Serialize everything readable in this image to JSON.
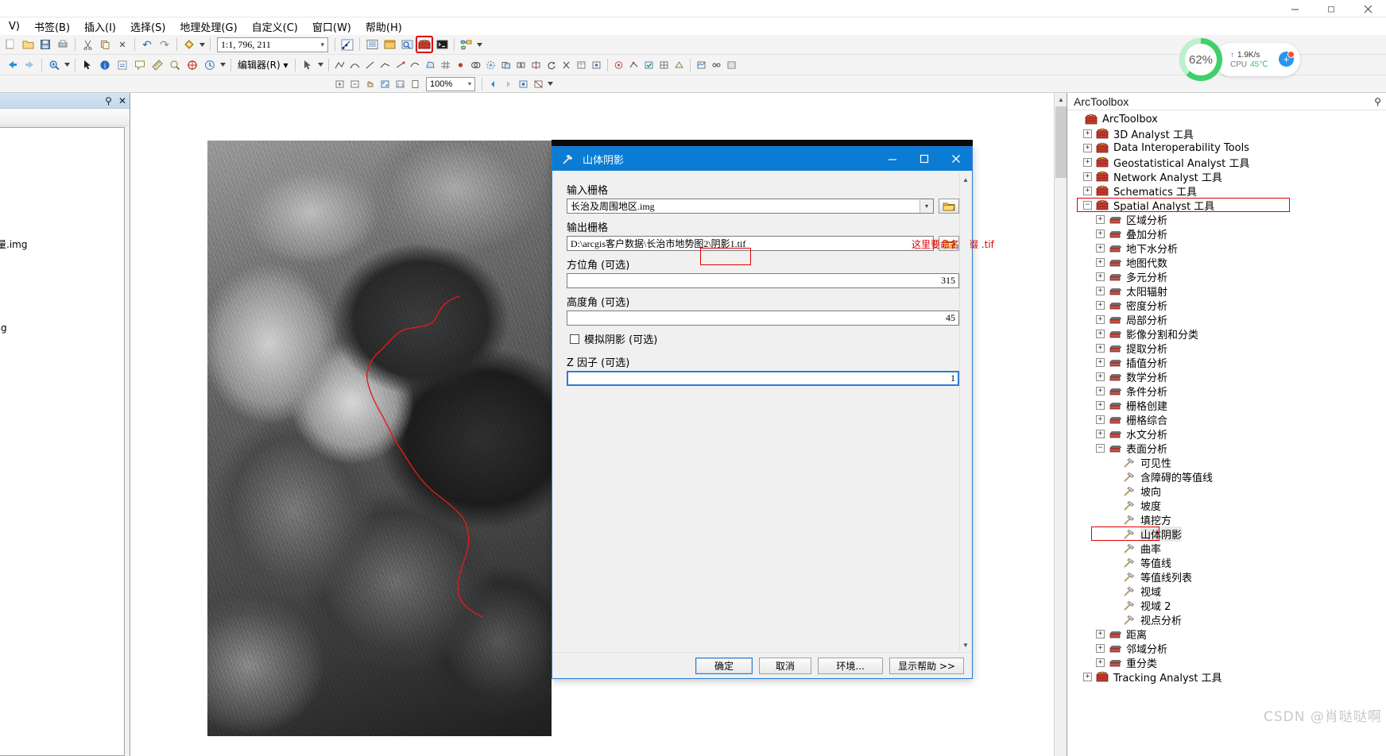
{
  "window": {
    "minimize": "—",
    "restore": "❐",
    "close": "✕"
  },
  "menubar": {
    "items": [
      {
        "label": "V)"
      },
      {
        "label": "书签(B)"
      },
      {
        "label": "插入(I)"
      },
      {
        "label": "选择(S)"
      },
      {
        "label": "地理处理(G)"
      },
      {
        "label": "自定义(C)"
      },
      {
        "label": "窗口(W)"
      },
      {
        "label": "帮助(H)"
      }
    ]
  },
  "toolbar": {
    "scale_value": "1:1, 796, 211",
    "zoom_value": "100%",
    "editor_label": "编辑器(R) ▾",
    "undo": "↶",
    "redo": "↷",
    "delete": "✕",
    "copy": "⎘"
  },
  "perf": {
    "percent": "62%",
    "net_speed": "1.9K/s",
    "cpu_label": "CPU",
    "cpu_temp": "45℃",
    "accent": "#3fd06a",
    "plus": "+"
  },
  "toc": {
    "pin": "⚲",
    "close": "✕",
    "layers": [
      {
        "label": "量.img"
      },
      {
        "label": "img"
      }
    ]
  },
  "arctoolbox": {
    "title": "ArcToolbox",
    "pin": "⚲",
    "tree": [
      {
        "label": "ArcToolbox",
        "depth": 0,
        "icon": "toolbox-root",
        "expander": "none"
      },
      {
        "label": "3D Analyst 工具",
        "depth": 1,
        "icon": "toolbox",
        "expander": "+"
      },
      {
        "label": "Data Interoperability Tools",
        "depth": 1,
        "icon": "toolbox",
        "expander": "+"
      },
      {
        "label": "Geostatistical Analyst 工具",
        "depth": 1,
        "icon": "toolbox",
        "expander": "+"
      },
      {
        "label": "Network Analyst 工具",
        "depth": 1,
        "icon": "toolbox",
        "expander": "+"
      },
      {
        "label": "Schematics 工具",
        "depth": 1,
        "icon": "toolbox",
        "expander": "+"
      },
      {
        "label": "Spatial Analyst 工具",
        "depth": 1,
        "icon": "toolbox",
        "expander": "−",
        "highlight": true
      },
      {
        "label": "区域分析",
        "depth": 2,
        "icon": "toolset",
        "expander": "+"
      },
      {
        "label": "叠加分析",
        "depth": 2,
        "icon": "toolset",
        "expander": "+"
      },
      {
        "label": "地下水分析",
        "depth": 2,
        "icon": "toolset",
        "expander": "+"
      },
      {
        "label": "地图代数",
        "depth": 2,
        "icon": "toolset",
        "expander": "+"
      },
      {
        "label": "多元分析",
        "depth": 2,
        "icon": "toolset",
        "expander": "+"
      },
      {
        "label": "太阳辐射",
        "depth": 2,
        "icon": "toolset",
        "expander": "+"
      },
      {
        "label": "密度分析",
        "depth": 2,
        "icon": "toolset",
        "expander": "+"
      },
      {
        "label": "局部分析",
        "depth": 2,
        "icon": "toolset",
        "expander": "+"
      },
      {
        "label": "影像分割和分类",
        "depth": 2,
        "icon": "toolset",
        "expander": "+"
      },
      {
        "label": "提取分析",
        "depth": 2,
        "icon": "toolset",
        "expander": "+"
      },
      {
        "label": "插值分析",
        "depth": 2,
        "icon": "toolset",
        "expander": "+"
      },
      {
        "label": "数学分析",
        "depth": 2,
        "icon": "toolset",
        "expander": "+"
      },
      {
        "label": "条件分析",
        "depth": 2,
        "icon": "toolset",
        "expander": "+"
      },
      {
        "label": "栅格创建",
        "depth": 2,
        "icon": "toolset",
        "expander": "+"
      },
      {
        "label": "栅格综合",
        "depth": 2,
        "icon": "toolset",
        "expander": "+"
      },
      {
        "label": "水文分析",
        "depth": 2,
        "icon": "toolset",
        "expander": "+"
      },
      {
        "label": "表面分析",
        "depth": 2,
        "icon": "toolset",
        "expander": "−"
      },
      {
        "label": "可见性",
        "depth": 3,
        "icon": "tool",
        "expander": "none"
      },
      {
        "label": "含障碍的等值线",
        "depth": 3,
        "icon": "tool",
        "expander": "none"
      },
      {
        "label": "坡向",
        "depth": 3,
        "icon": "tool",
        "expander": "none"
      },
      {
        "label": "坡度",
        "depth": 3,
        "icon": "tool",
        "expander": "none"
      },
      {
        "label": "填挖方",
        "depth": 3,
        "icon": "tool",
        "expander": "none"
      },
      {
        "label": "山体阴影",
        "depth": 3,
        "icon": "tool",
        "expander": "none",
        "highlight": true,
        "selected": true
      },
      {
        "label": "曲率",
        "depth": 3,
        "icon": "tool",
        "expander": "none"
      },
      {
        "label": "等值线",
        "depth": 3,
        "icon": "tool",
        "expander": "none"
      },
      {
        "label": "等值线列表",
        "depth": 3,
        "icon": "tool",
        "expander": "none"
      },
      {
        "label": "视域",
        "depth": 3,
        "icon": "tool",
        "expander": "none"
      },
      {
        "label": "视域 2",
        "depth": 3,
        "icon": "tool",
        "expander": "none"
      },
      {
        "label": "视点分析",
        "depth": 3,
        "icon": "tool",
        "expander": "none"
      },
      {
        "label": "距离",
        "depth": 2,
        "icon": "toolset",
        "expander": "+"
      },
      {
        "label": "邻域分析",
        "depth": 2,
        "icon": "toolset",
        "expander": "+"
      },
      {
        "label": "重分类",
        "depth": 2,
        "icon": "toolset",
        "expander": "+"
      },
      {
        "label": "Tracking Analyst 工具",
        "depth": 1,
        "icon": "toolbox",
        "expander": "+"
      }
    ]
  },
  "dialog": {
    "title": "山体阴影",
    "minimize": "—",
    "maximize": "❐",
    "close": "✕",
    "fields": {
      "input_raster_label": "输入栅格",
      "input_raster_value": "长治及周围地区.img",
      "output_raster_label": "输出栅格",
      "output_raster_value": "D:\\arcgis客户数据\\长治市地势图2\\阴影1.tif",
      "azimuth_label": "方位角 (可选)",
      "azimuth_value": "315",
      "altitude_label": "高度角 (可选)",
      "altitude_value": "45",
      "model_shadows_label": "模拟阴影 (可选)",
      "zfactor_label": "Z 因子 (可选)",
      "zfactor_value": "1"
    },
    "annotation": "这里要命名后缀 .tif",
    "annotation_color": "#e00000",
    "buttons": {
      "ok": "确定",
      "cancel": "取消",
      "environments": "环境...",
      "show_help": "显示帮助 >>"
    }
  },
  "watermark": "CSDN @肖哒哒啊"
}
